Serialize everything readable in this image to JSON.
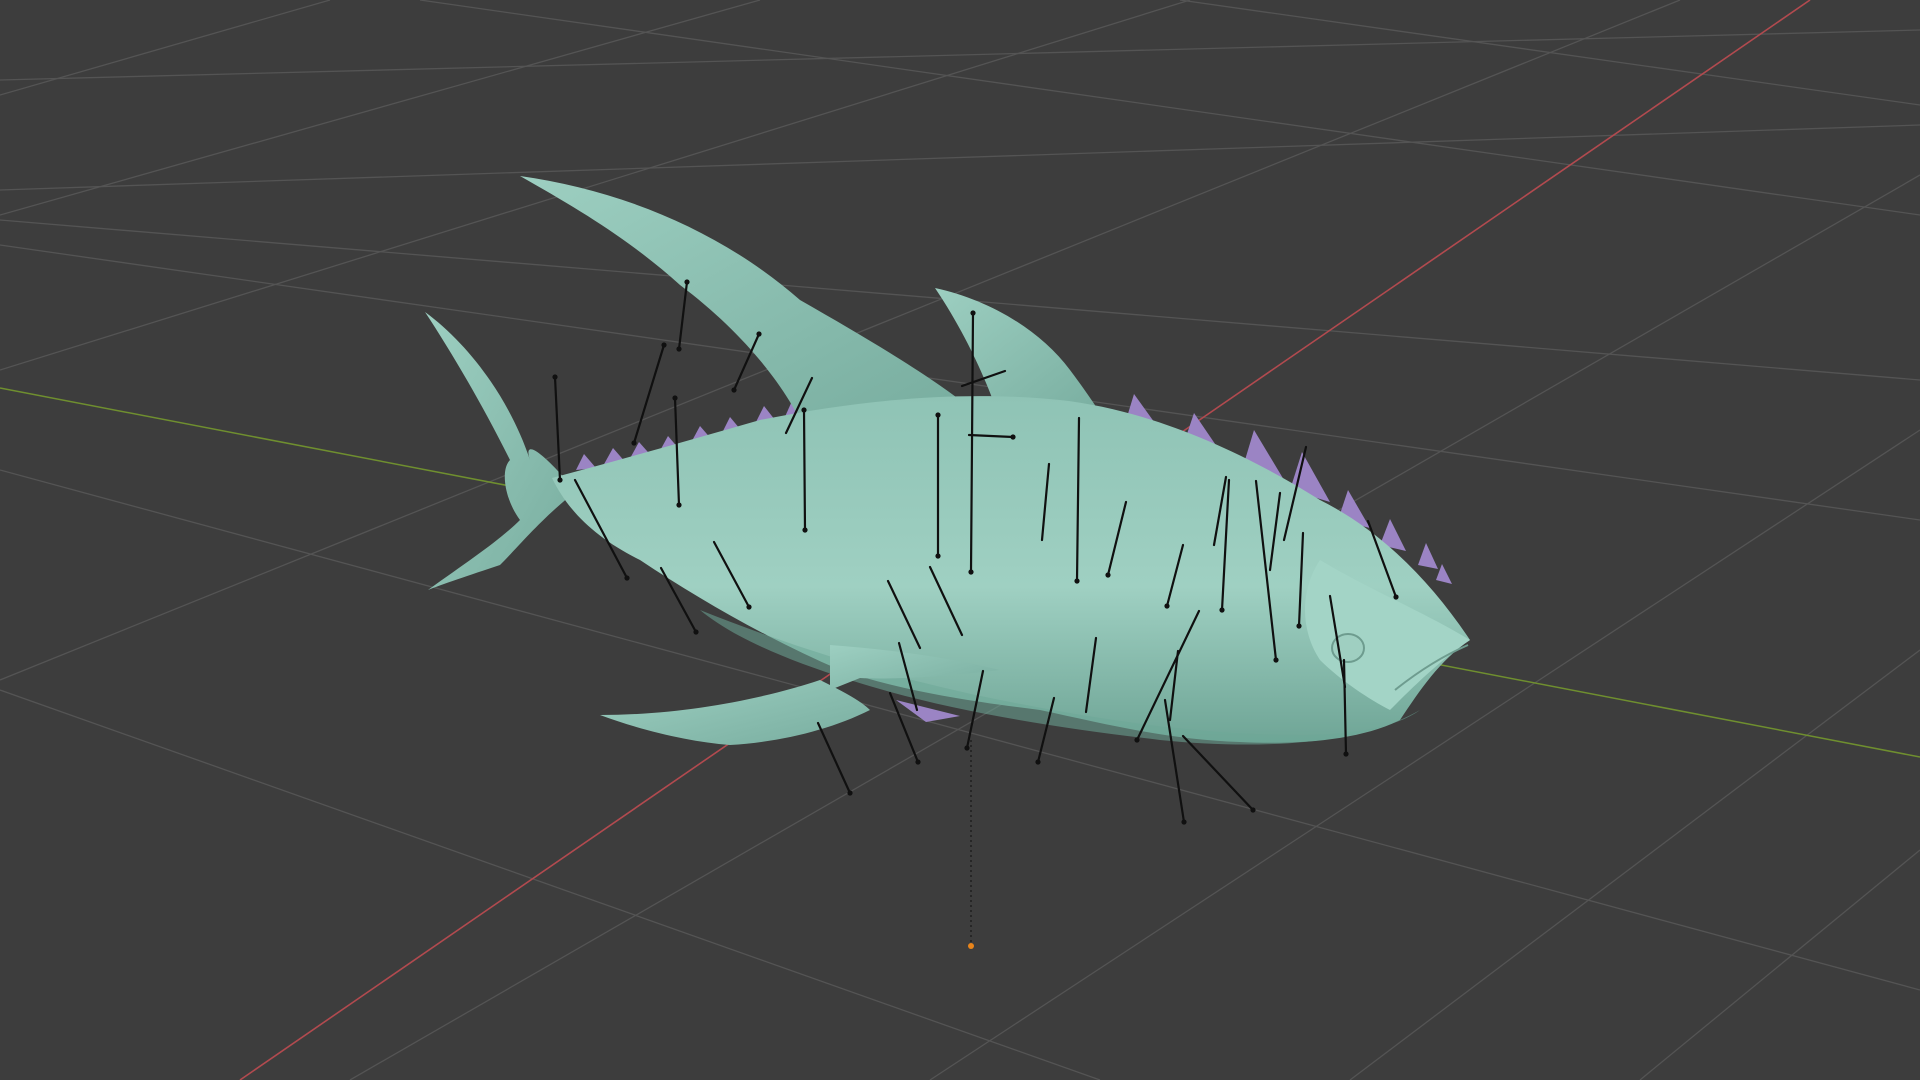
{
  "viewport": {
    "background": "#3d3d3d",
    "grid_color": "#545454",
    "axis_x_color": "#b24a4f",
    "axis_y_color": "#6f8f2f",
    "mesh_color": "#93c5b7",
    "mesh_shade_color": "#6ea898",
    "fin_spike_color": "#9b84c4",
    "bone_color": "#101010",
    "origin_color": "#e8841a"
  },
  "object": {
    "mesh_name_icon": "fish-mesh-icon",
    "armature_icon": "armature-bones-icon",
    "origin_icon": "object-origin-icon"
  }
}
